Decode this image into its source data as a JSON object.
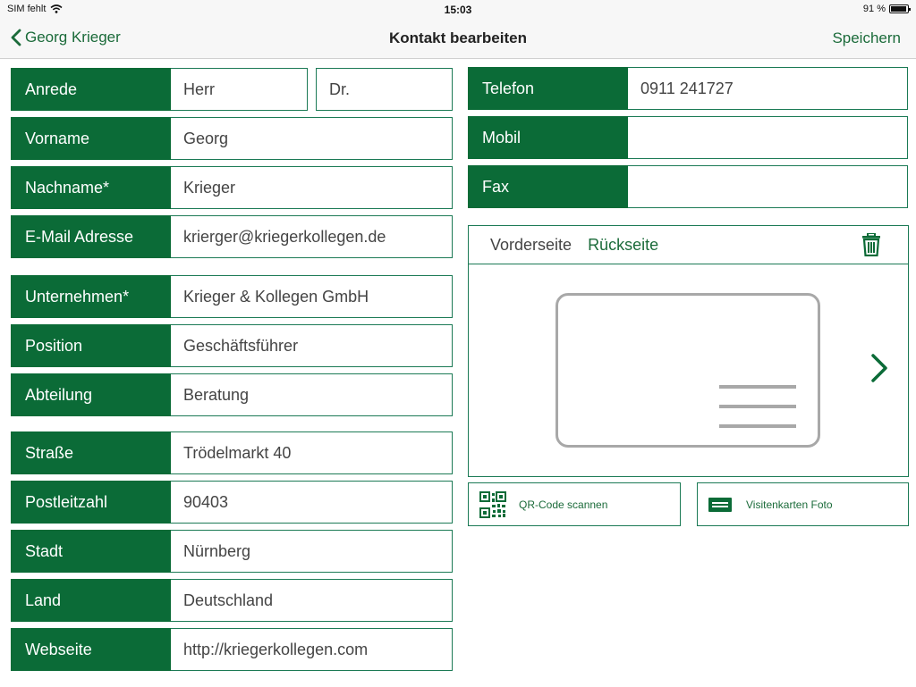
{
  "status_bar": {
    "carrier": "SIM fehlt",
    "time": "15:03",
    "battery": "91 %"
  },
  "nav": {
    "back_label": "Georg Krieger",
    "title": "Kontakt bearbeiten",
    "save_label": "Speichern"
  },
  "form_left": {
    "anrede": {
      "label": "Anrede",
      "value": "Herr",
      "title": "Dr."
    },
    "vorname": {
      "label": "Vorname",
      "value": "Georg"
    },
    "nachname": {
      "label": "Nachname*",
      "value": "Krieger"
    },
    "email": {
      "label": "E-Mail Adresse",
      "value": "krierger@kriegerkollegen.de"
    },
    "unternehmen": {
      "label": "Unternehmen*",
      "value": "Krieger & Kollegen GmbH"
    },
    "position": {
      "label": "Position",
      "value": "Geschäftsführer"
    },
    "abteilung": {
      "label": "Abteilung",
      "value": "Beratung"
    },
    "strasse": {
      "label": "Straße",
      "value": "Trödelmarkt 40"
    },
    "plz": {
      "label": "Postleitzahl",
      "value": "90403"
    },
    "stadt": {
      "label": "Stadt",
      "value": "Nürnberg"
    },
    "land": {
      "label": "Land",
      "value": "Deutschland"
    },
    "webseite": {
      "label": "Webseite",
      "value": "http://kriegerkollegen.com"
    }
  },
  "form_right": {
    "telefon": {
      "label": "Telefon",
      "value": "0911 241727"
    },
    "mobil": {
      "label": "Mobil",
      "value": ""
    },
    "fax": {
      "label": "Fax",
      "value": ""
    }
  },
  "card": {
    "tab_front": "Vorderseite",
    "tab_back": "Rückseite",
    "delete_icon": "trash-icon"
  },
  "actions": {
    "qr_label": "QR-Code scannen",
    "photo_label": "Visitenkarten Foto"
  },
  "colors": {
    "brand": "#0b6b37",
    "accent": "#1b6b3a"
  }
}
